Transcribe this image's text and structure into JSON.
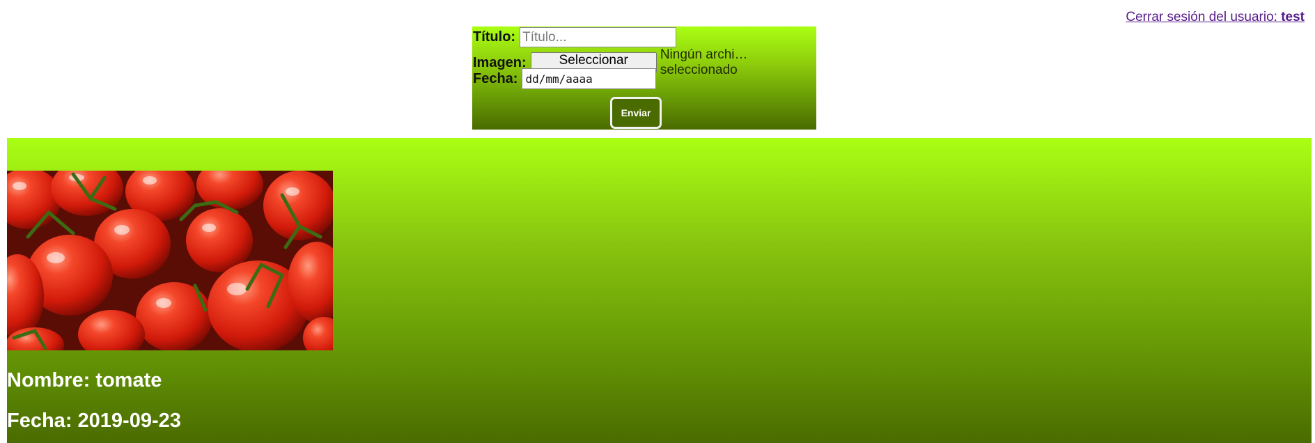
{
  "header": {
    "logout_label": "Cerrar sesión del usuario: ",
    "username": "test"
  },
  "form": {
    "title_label": "Título:",
    "title_placeholder": "Título...",
    "image_label": "Imagen:",
    "file_button_label": "Seleccionar archivo",
    "file_status": "Ningún archi…seleccionado",
    "date_label": "Fecha:",
    "date_placeholder": "dd/mm/aaaa",
    "submit_label": "Enviar"
  },
  "entries": [
    {
      "image_icon": "tomatoes-photo",
      "name_text": "Nombre: tomate",
      "date_text": "Fecha: 2019-09-23"
    }
  ],
  "colors": {
    "gradient_top": "#aaff14",
    "gradient_bottom": "#4a6b00",
    "link": "#551a8b"
  }
}
